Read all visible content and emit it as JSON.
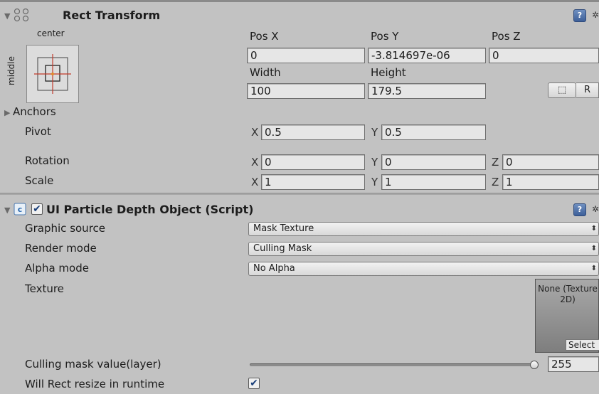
{
  "rect_transform": {
    "title": "Rect Transform",
    "anchor_preset": {
      "horizontal": "center",
      "vertical": "middle"
    },
    "labels": {
      "pos_x": "Pos X",
      "pos_y": "Pos Y",
      "pos_z": "Pos Z",
      "width": "Width",
      "height": "Height"
    },
    "pos_x": "0",
    "pos_y": "-3.814697e-06",
    "pos_z": "0",
    "width": "100",
    "height": "179.5",
    "raw_button": "R",
    "anchors_label": "Anchors",
    "pivot": {
      "label": "Pivot",
      "x_axis": "X",
      "y_axis": "Y",
      "x": "0.5",
      "y": "0.5"
    },
    "rotation": {
      "label": "Rotation",
      "x_axis": "X",
      "y_axis": "Y",
      "z_axis": "Z",
      "x": "0",
      "y": "0",
      "z": "0"
    },
    "scale": {
      "label": "Scale",
      "x_axis": "X",
      "y_axis": "Y",
      "z_axis": "Z",
      "x": "1",
      "y": "1",
      "z": "1"
    }
  },
  "script_component": {
    "title": "UI Particle Depth Object",
    "title_suffix": "(Script)",
    "enabled": true,
    "graphic_source": {
      "label": "Graphic source",
      "value": "Mask Texture"
    },
    "render_mode": {
      "label": "Render mode",
      "value": "Culling Mask"
    },
    "alpha_mode": {
      "label": "Alpha mode",
      "value": "No Alpha"
    },
    "texture": {
      "label": "Texture",
      "value": "None (Texture 2D)",
      "select": "Select"
    },
    "culling_mask": {
      "label": "Culling mask value(layer)",
      "value": "255",
      "slider_fraction": 1.0
    },
    "will_rect_resize": {
      "label": "Will Rect resize in runtime",
      "checked": true
    }
  },
  "icons": {
    "fold_open": "▼",
    "fold_closed": "▶",
    "help": "?",
    "gear": "✲",
    "check": "✔",
    "dropdown_arrow": "⬍",
    "blueprint": "⬚"
  }
}
